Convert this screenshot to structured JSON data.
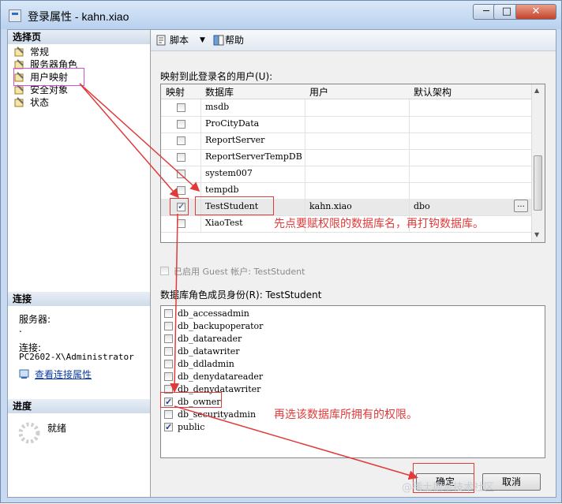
{
  "window": {
    "title": "登录属性 - kahn.xiao",
    "controls": [
      "─",
      "□",
      "✕"
    ]
  },
  "left": {
    "select_page_header": "选择页",
    "pages": [
      "常规",
      "服务器角色",
      "用户映射",
      "安全对象",
      "状态"
    ],
    "connection_header": "连接",
    "server_label": "服务器:",
    "server_value": ".",
    "connection_label": "连接:",
    "connection_value": "PC2602-X\\Administrator",
    "view_conn_link": "查看连接属性",
    "progress_header": "进度",
    "progress_status": "就绪"
  },
  "toolbar": {
    "script_label": "脚本",
    "help_label": "帮助",
    "script_icon": "script-icon",
    "help_icon": "help-icon"
  },
  "mapping": {
    "label": "映射到此登录名的用户(U):",
    "columns": [
      "映射",
      "数据库",
      "用户",
      "默认架构"
    ],
    "rows": [
      {
        "checked": false,
        "db": "msdb",
        "user": "",
        "schema": ""
      },
      {
        "checked": false,
        "db": "ProCityData",
        "user": "",
        "schema": ""
      },
      {
        "checked": false,
        "db": "ReportServer",
        "user": "",
        "schema": ""
      },
      {
        "checked": false,
        "db": "ReportServerTempDB",
        "user": "",
        "schema": ""
      },
      {
        "checked": false,
        "db": "system007",
        "user": "",
        "schema": ""
      },
      {
        "checked": false,
        "db": "tempdb",
        "user": "",
        "schema": ""
      },
      {
        "checked": true,
        "db": "TestStudent",
        "user": "kahn.xiao",
        "schema": "dbo"
      },
      {
        "checked": false,
        "db": "XiaoTest",
        "user": "",
        "schema": ""
      }
    ],
    "ellipsis": "..."
  },
  "guest": {
    "label": "已启用 Guest 帐户: TestStudent"
  },
  "roles": {
    "label": "数据库角色成员身份(R): TestStudent",
    "items": [
      {
        "name": "db_accessadmin",
        "checked": false
      },
      {
        "name": "db_backupoperator",
        "checked": false
      },
      {
        "name": "db_datareader",
        "checked": false
      },
      {
        "name": "db_datawriter",
        "checked": false
      },
      {
        "name": "db_ddladmin",
        "checked": false
      },
      {
        "name": "db_denydatareader",
        "checked": false
      },
      {
        "name": "db_denydatawriter",
        "checked": false
      },
      {
        "name": "db_owner",
        "checked": true
      },
      {
        "name": "db_securityadmin",
        "checked": false
      },
      {
        "name": "public",
        "checked": true
      }
    ]
  },
  "buttons": {
    "ok": "确定",
    "cancel": "取消"
  },
  "annotations": {
    "first": "先点要赋权限的数据库名，再打钩数据库。",
    "second": "再选该数据库所拥有的权限。"
  },
  "watermark": "@稀土掘金技术社区",
  "colors": {
    "annotation": "#e03a3a",
    "highlight": "#d34ed8"
  }
}
